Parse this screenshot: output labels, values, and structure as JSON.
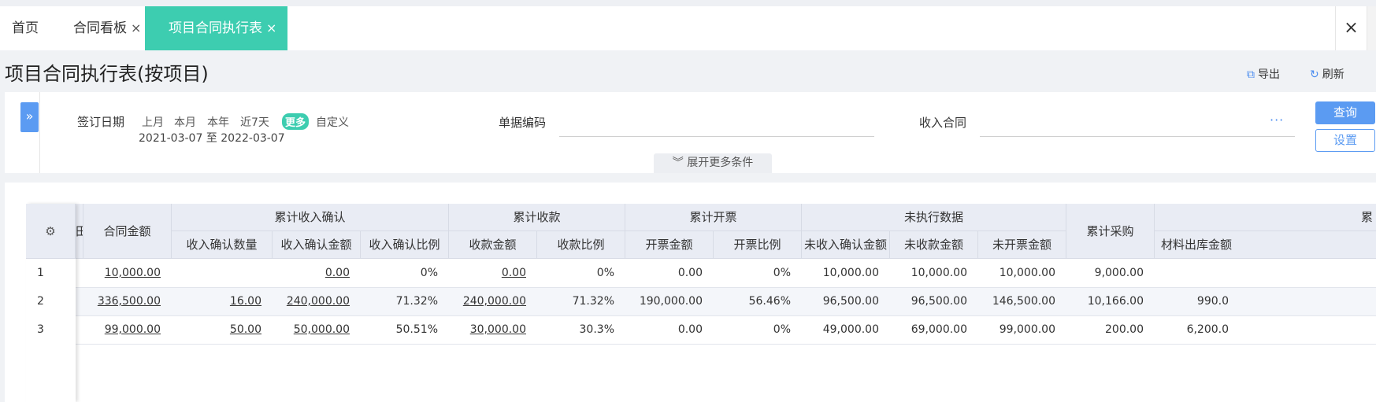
{
  "tabs": [
    {
      "label": "首页",
      "closable": false
    },
    {
      "label": "合同看板",
      "closable": true
    },
    {
      "label": "项目合同执行表",
      "closable": true,
      "active": true
    }
  ],
  "close_glyph": "×",
  "page": {
    "title": "项目合同执行表(按项目)",
    "export_label": "导出",
    "refresh_label": "刷新"
  },
  "filter": {
    "sign_date_label": "签订日期",
    "presets": [
      "上月",
      "本月",
      "本年",
      "近7天",
      "更多",
      "自定义"
    ],
    "selected_preset": "更多",
    "date_range": "2021-03-07 至 2022-03-07",
    "doc_code_label": "单据编码",
    "doc_code_value": "",
    "income_contract_label": "收入合同",
    "income_contract_value": "",
    "query_label": "查询",
    "settings_label": "设置",
    "expand_label": "展开更多条件"
  },
  "table": {
    "partial_left_header": "田",
    "group_headers": {
      "contract_amount": "合同金额",
      "cum_income_confirm": "累计收入确认",
      "cum_collection": "累计收款",
      "cum_invoice": "累计开票",
      "unexecuted": "未执行数据",
      "cum_purchase": "累计采购",
      "partial_right": "累"
    },
    "sub_headers": {
      "confirm_qty": "收入确认数量",
      "confirm_amount": "收入确认金额",
      "confirm_ratio": "收入确认比例",
      "collect_amount": "收款金额",
      "collect_ratio": "收款比例",
      "invoice_amount": "开票金额",
      "invoice_ratio": "开票比例",
      "un_confirm_amount": "未收入确认金额",
      "un_collect_amount": "未收款金额",
      "un_invoice_amount": "未开票金额",
      "material_out": "材料出库金额"
    },
    "rows": [
      {
        "idx": "1",
        "contract_amount": "10,000.00",
        "confirm_qty": "",
        "confirm_amount": "0.00",
        "confirm_ratio": "0%",
        "collect_amount": "0.00",
        "collect_ratio": "0%",
        "invoice_amount": "0.00",
        "invoice_ratio": "0%",
        "un_confirm_amount": "10,000.00",
        "un_collect_amount": "10,000.00",
        "un_invoice_amount": "10,000.00",
        "cum_purchase": "9,000.00",
        "material_out": ""
      },
      {
        "idx": "2",
        "contract_amount": "336,500.00",
        "confirm_qty": "16.00",
        "confirm_amount": "240,000.00",
        "confirm_ratio": "71.32%",
        "collect_amount": "240,000.00",
        "collect_ratio": "71.32%",
        "invoice_amount": "190,000.00",
        "invoice_ratio": "56.46%",
        "un_confirm_amount": "96,500.00",
        "un_collect_amount": "96,500.00",
        "un_invoice_amount": "146,500.00",
        "cum_purchase": "10,166.00",
        "material_out": "990.0"
      },
      {
        "idx": "3",
        "contract_amount": "99,000.00",
        "confirm_qty": "50.00",
        "confirm_amount": "50,000.00",
        "confirm_ratio": "50.51%",
        "collect_amount": "30,000.00",
        "collect_ratio": "30.3%",
        "invoice_amount": "0.00",
        "invoice_ratio": "0%",
        "un_confirm_amount": "49,000.00",
        "un_collect_amount": "69,000.00",
        "un_invoice_amount": "99,000.00",
        "cum_purchase": "200.00",
        "material_out": "6,200.0"
      }
    ]
  },
  "colors": {
    "accent": "#3dcdb0",
    "primary": "#5b9bf2",
    "header_bg": "#e9ecf4"
  }
}
